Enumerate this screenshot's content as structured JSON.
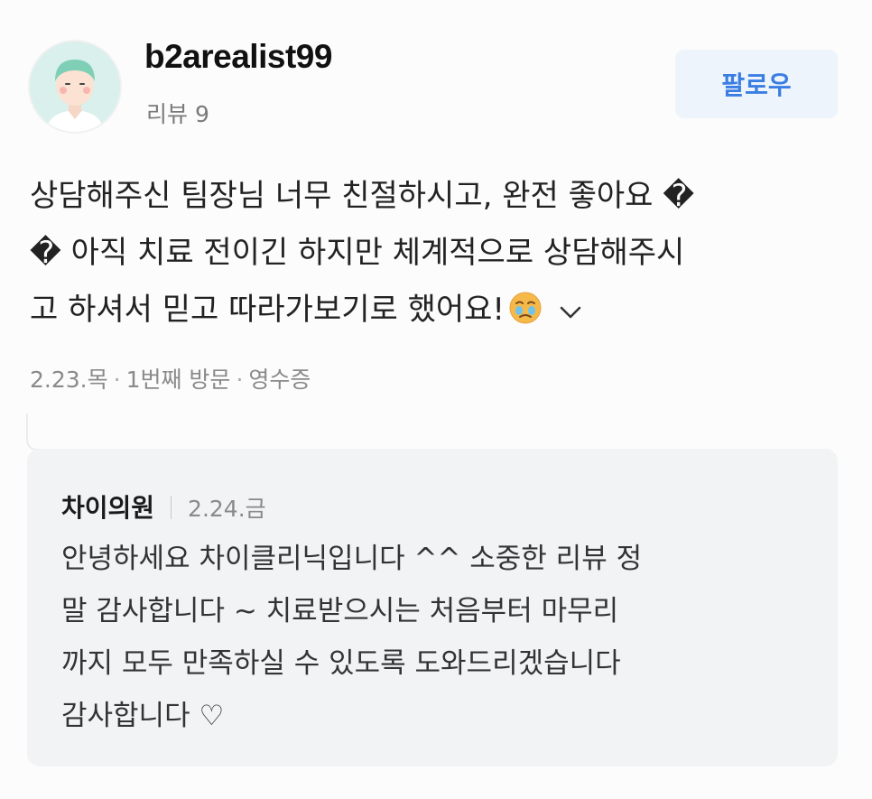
{
  "reviewer": {
    "username": "b2arealist99",
    "review_count": "리뷰 9"
  },
  "follow": {
    "label": "팔로우"
  },
  "review": {
    "lines": [
      "상담해주신 팀장님 너무 친절하시고, 완전 좋아요 �",
      "� 아직 치료 전이긴 하지만 체계적으로 상담해주시",
      "고 하셔서 믿고 따라가보기로 했어요!"
    ],
    "emoji_icon": "crying-face-emoji-icon",
    "expand_icon": "chevron-down-icon"
  },
  "meta": {
    "date": "2.23.목",
    "visit": "1번째 방문",
    "verification": "영수증",
    "separator": "·"
  },
  "reply": {
    "author": "차이의원",
    "date": "2.24.금",
    "lines": [
      "안녕하세요 차이클리닉입니다 ^^ 소중한 리뷰 정",
      "말 감사합니다 ~ 치료받으시는 처음부터 마무리",
      "까지 모두 만족하실 수 있도록 도와드리겠습니다",
      "감사합니다 ♡"
    ]
  },
  "colors": {
    "accent": "#3a7ee3",
    "follow_bg": "#eef4fc",
    "reply_bg": "#f1f3f5",
    "avatar_bg": "#d9f0ec"
  }
}
